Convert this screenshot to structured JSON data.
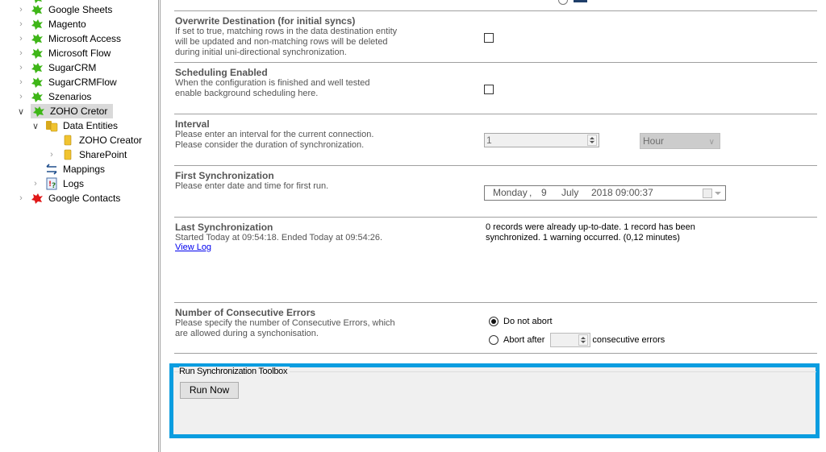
{
  "sidebar": {
    "items": [
      {
        "label": "Google Sheets",
        "icon": "plugin-green-icon",
        "expander": "collapsed"
      },
      {
        "label": "Magento",
        "icon": "plugin-green-icon",
        "expander": "collapsed"
      },
      {
        "label": "Microsoft Access",
        "icon": "plugin-green-icon",
        "expander": "collapsed"
      },
      {
        "label": "Microsoft Flow",
        "icon": "plugin-green-icon",
        "expander": "collapsed"
      },
      {
        "label": "SugarCRM",
        "icon": "plugin-green-icon",
        "expander": "collapsed"
      },
      {
        "label": "SugarCRMFlow",
        "icon": "plugin-green-icon",
        "expander": "collapsed"
      },
      {
        "label": "Szenarios",
        "icon": "plugin-green-icon",
        "expander": "collapsed"
      },
      {
        "label": "ZOHO Cretor",
        "icon": "plugin-green-icon",
        "expander": "expanded",
        "selected": true
      },
      {
        "label": "Data Entities",
        "icon": "database-group-icon",
        "expander": "expanded"
      },
      {
        "label": "ZOHO Creator",
        "icon": "database-icon",
        "expander": "none"
      },
      {
        "label": "SharePoint",
        "icon": "database-icon",
        "expander": "collapsed"
      },
      {
        "label": "Mappings",
        "icon": "mappings-icon",
        "expander": "none"
      },
      {
        "label": "Logs",
        "icon": "logs-icon",
        "expander": "collapsed"
      },
      {
        "label": "Google Contacts",
        "icon": "plugin-red-icon",
        "expander": "collapsed"
      }
    ]
  },
  "settings": {
    "overwrite": {
      "title": "Overwrite Destination (for initial syncs)",
      "desc": [
        "If set to true, matching rows in the data destination entity",
        "will be updated and non-matching rows will be deleted",
        "during initial uni-directional synchronization."
      ],
      "checked": false
    },
    "scheduling": {
      "title": "Scheduling Enabled",
      "desc": [
        "When the configuration is finished and well tested",
        "enable background scheduling here."
      ],
      "checked": false
    },
    "interval": {
      "title": "Interval",
      "desc": [
        "Please enter an interval for the current connection.",
        "Please consider the duration of synchronization."
      ],
      "value": "1",
      "unit": "Hour"
    },
    "first_sync": {
      "title": "First Synchronization",
      "desc": [
        "Please enter date and time for first run."
      ],
      "weekday": "Monday",
      "sep": ",",
      "day": "9",
      "month": "July",
      "year_time": "2018 09:00:37"
    },
    "last_sync": {
      "title": "Last Synchronization",
      "desc": "Started  Today at 09:54:18. Ended Today at 09:54:26.",
      "link": "View Log",
      "result": [
        "0 records were already up-to-date. 1 record has been",
        "synchronized. 1 warning occurred. (0,12 minutes)"
      ]
    },
    "consecutive_errors": {
      "title": "Number of Consecutive Errors",
      "desc": [
        "Please specify the number of Consecutive Errors, which",
        "are allowed during a synchonisation."
      ],
      "option_no_abort": "Do not abort",
      "option_abort_after": "Abort after",
      "suffix": "consecutive errors",
      "selected": "no_abort",
      "abort_value": ""
    }
  },
  "toolbox": {
    "title": "Run Synchronization Toolbox",
    "run_button": "Run Now",
    "highlight_color": "#0a9de0"
  }
}
